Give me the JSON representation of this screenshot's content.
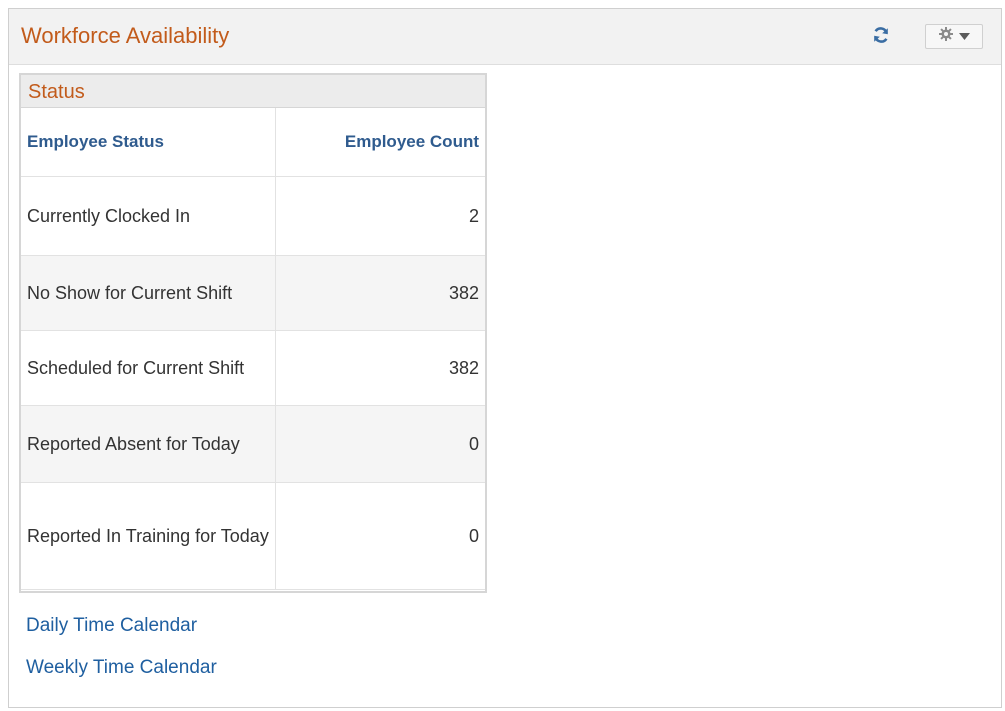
{
  "pagelet": {
    "title": "Workforce Availability",
    "refresh_icon": "refresh-icon",
    "options_icon": "gear-icon"
  },
  "status_grid": {
    "title": "Status",
    "headers": {
      "status": "Employee Status",
      "count": "Employee Count"
    },
    "rows": [
      {
        "status": "Currently Clocked In",
        "count": "2"
      },
      {
        "status": "No Show for Current Shift",
        "count": "382"
      },
      {
        "status": "Scheduled for Current Shift",
        "count": "382"
      },
      {
        "status": "Reported Absent for Today",
        "count": "0"
      },
      {
        "status": "Reported In Training for Today",
        "count": "0"
      }
    ]
  },
  "links": {
    "daily": "Daily Time Calendar",
    "weekly": "Weekly Time Calendar"
  },
  "colors": {
    "title_accent": "#c25b1b",
    "header_link": "#2f5b8e",
    "link": "#1f5fa0"
  }
}
